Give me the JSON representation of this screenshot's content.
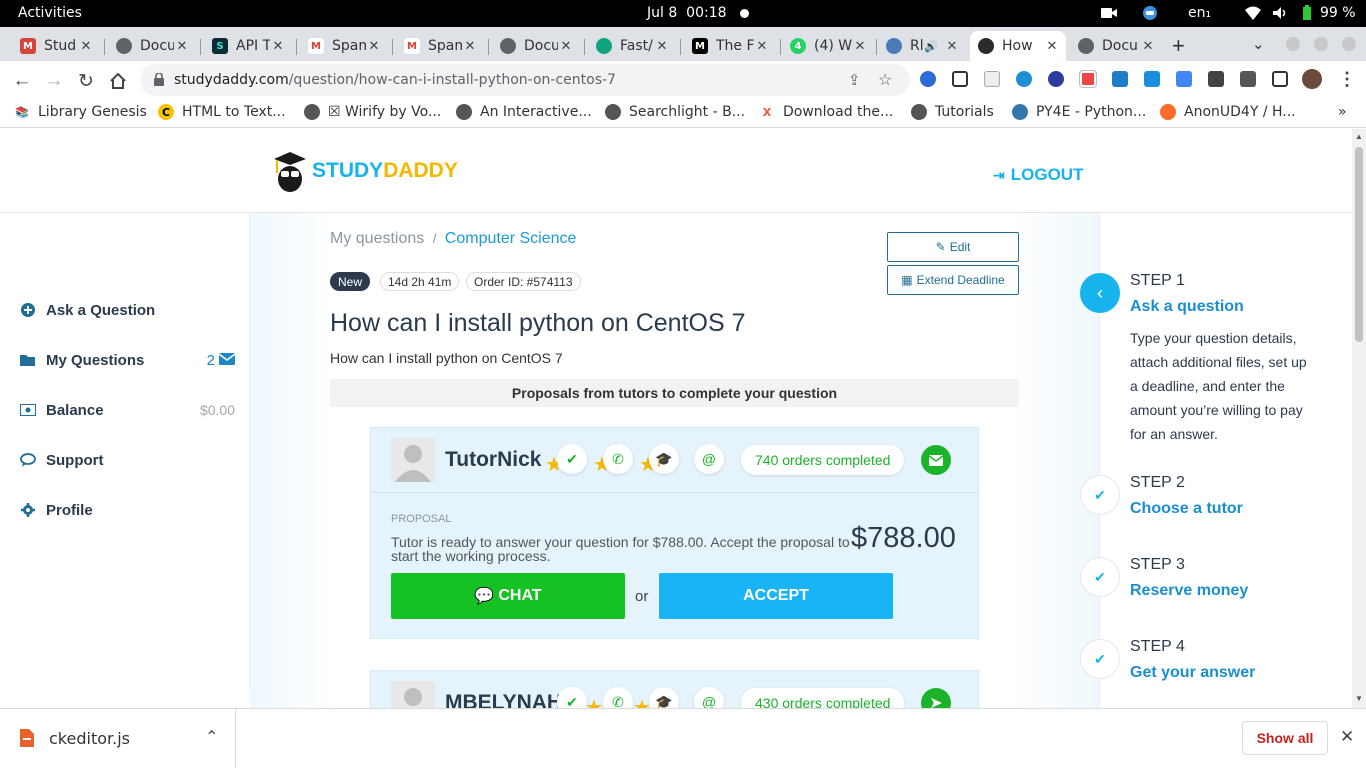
{
  "system": {
    "activities": "Activities",
    "date": "Jul 8",
    "time": "00:18",
    "lang": "en₁",
    "battery": "99 %"
  },
  "tabs": [
    {
      "label": "Stud",
      "icon": "gmail-icon"
    },
    {
      "label": "Docu",
      "icon": "globe-icon"
    },
    {
      "label": "API T",
      "icon": "api-icon"
    },
    {
      "label": "Spam",
      "icon": "gmail-icon"
    },
    {
      "label": "Spam",
      "icon": "gmail-icon"
    },
    {
      "label": "Docu",
      "icon": "globe-icon"
    },
    {
      "label": "Fast/",
      "icon": "openai-icon"
    },
    {
      "label": "The F",
      "icon": "medium-icon"
    },
    {
      "label": "(4) W",
      "icon": "whatsapp-icon"
    },
    {
      "label": "Rl",
      "icon": "kube-icon"
    },
    {
      "label": "How",
      "icon": "studydaddy-icon"
    },
    {
      "label": "Docu",
      "icon": "globe-icon"
    }
  ],
  "url": {
    "domain": "studydaddy.com",
    "path": "/question/how-can-i-install-python-on-centos-7"
  },
  "bookmarks": [
    {
      "label": "Library Genesis",
      "icon": "book-icon"
    },
    {
      "label": "HTML to Text...",
      "icon": "c-icon"
    },
    {
      "label": "☒ Wirify by Vo...",
      "icon": "globe-icon"
    },
    {
      "label": "An Interactive...",
      "icon": "globe-icon"
    },
    {
      "label": "Searchlight - B...",
      "icon": "globe-icon"
    },
    {
      "label": "Download the...",
      "icon": "x-icon"
    },
    {
      "label": "Tutorials",
      "icon": "globe-icon"
    },
    {
      "label": "PY4E - Python...",
      "icon": "python-icon"
    },
    {
      "label": "AnonUD4Y / H...",
      "icon": "gitlab-icon"
    }
  ],
  "site": {
    "logo_study": "STUDY",
    "logo_daddy": "DADDY",
    "logout": "LOGOUT",
    "sidebar": [
      {
        "label": "Ask a Question",
        "icon": "plus-circle-icon",
        "right": ""
      },
      {
        "label": "My Questions",
        "icon": "folder-icon",
        "right": "2"
      },
      {
        "label": "Balance",
        "icon": "money-icon",
        "right": "$0.00"
      },
      {
        "label": "Support",
        "icon": "chat-icon",
        "right": ""
      },
      {
        "label": "Profile",
        "icon": "gear-icon",
        "right": ""
      }
    ]
  },
  "question": {
    "crumb_root": "My questions",
    "crumb_sep": "/",
    "crumb_category": "Computer Science",
    "edit": "Edit",
    "extend": "Extend Deadline",
    "badge_new": "New",
    "badge_time": "14d 2h 41m",
    "badge_order": "Order ID: #574113",
    "title": "How can I install python on CentOS 7",
    "body": "How can I install python on CentOS 7",
    "proposals_header": "Proposals from tutors to complete your question"
  },
  "proposals": [
    {
      "tutor": "TutorNick",
      "orders": "740 orders completed",
      "proposal_label": "PROPOSAL",
      "text": "Tutor is ready to answer your question for $788.00. Accept the proposal to start the working process.",
      "price": "$788.00",
      "chat": "CHAT",
      "or": "or",
      "accept": "ACCEPT"
    },
    {
      "tutor": "MBELYNAH",
      "orders": "430 orders completed"
    }
  ],
  "steps": [
    {
      "label": "STEP 1",
      "title": "Ask a question",
      "desc": "Type your question details, attach additional files, set up a deadline, and enter the amount you’re willing to pay for an answer."
    },
    {
      "label": "STEP 2",
      "title": "Choose a tutor"
    },
    {
      "label": "STEP 3",
      "title": "Reserve money"
    },
    {
      "label": "STEP 4",
      "title": "Get your answer"
    }
  ],
  "download": {
    "file": "ckeditor.js",
    "show_all": "Show all"
  },
  "colors": {
    "accent": "#17b3ec",
    "chat_green": "#16c124",
    "accept_blue": "#18b4f5",
    "logo_yellow": "#f5b800"
  }
}
